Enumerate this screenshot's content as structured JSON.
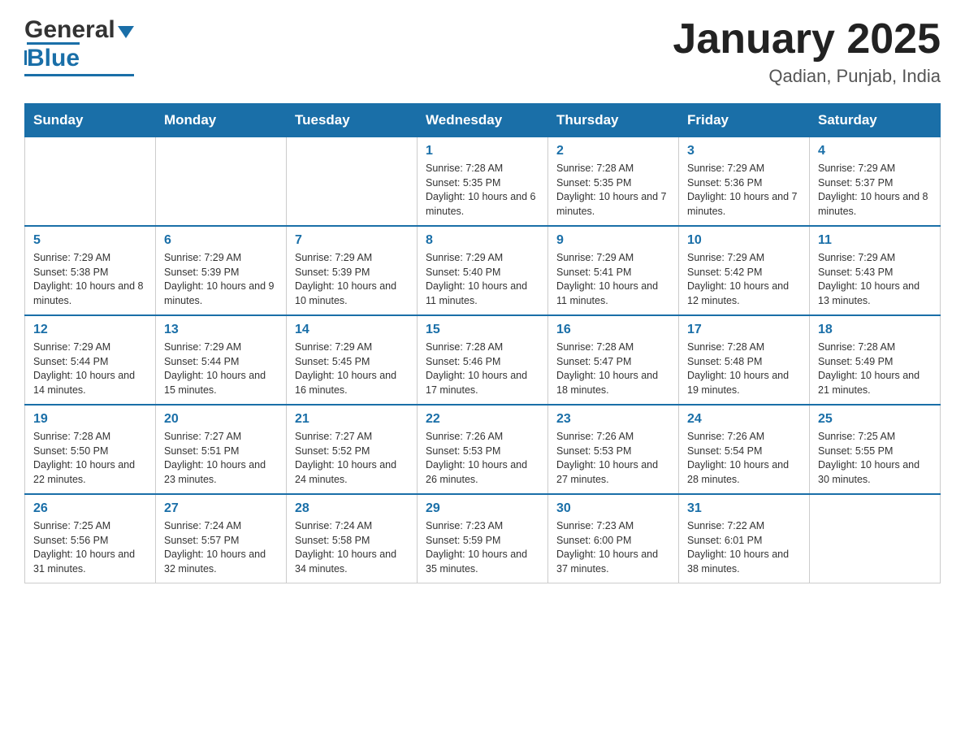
{
  "header": {
    "logo_general": "General",
    "logo_blue": "Blue",
    "month_title": "January 2025",
    "location": "Qadian, Punjab, India"
  },
  "days_of_week": [
    "Sunday",
    "Monday",
    "Tuesday",
    "Wednesday",
    "Thursday",
    "Friday",
    "Saturday"
  ],
  "weeks": [
    [
      {
        "day": "",
        "info": ""
      },
      {
        "day": "",
        "info": ""
      },
      {
        "day": "",
        "info": ""
      },
      {
        "day": "1",
        "info": "Sunrise: 7:28 AM\nSunset: 5:35 PM\nDaylight: 10 hours and 6 minutes."
      },
      {
        "day": "2",
        "info": "Sunrise: 7:28 AM\nSunset: 5:35 PM\nDaylight: 10 hours and 7 minutes."
      },
      {
        "day": "3",
        "info": "Sunrise: 7:29 AM\nSunset: 5:36 PM\nDaylight: 10 hours and 7 minutes."
      },
      {
        "day": "4",
        "info": "Sunrise: 7:29 AM\nSunset: 5:37 PM\nDaylight: 10 hours and 8 minutes."
      }
    ],
    [
      {
        "day": "5",
        "info": "Sunrise: 7:29 AM\nSunset: 5:38 PM\nDaylight: 10 hours and 8 minutes."
      },
      {
        "day": "6",
        "info": "Sunrise: 7:29 AM\nSunset: 5:39 PM\nDaylight: 10 hours and 9 minutes."
      },
      {
        "day": "7",
        "info": "Sunrise: 7:29 AM\nSunset: 5:39 PM\nDaylight: 10 hours and 10 minutes."
      },
      {
        "day": "8",
        "info": "Sunrise: 7:29 AM\nSunset: 5:40 PM\nDaylight: 10 hours and 11 minutes."
      },
      {
        "day": "9",
        "info": "Sunrise: 7:29 AM\nSunset: 5:41 PM\nDaylight: 10 hours and 11 minutes."
      },
      {
        "day": "10",
        "info": "Sunrise: 7:29 AM\nSunset: 5:42 PM\nDaylight: 10 hours and 12 minutes."
      },
      {
        "day": "11",
        "info": "Sunrise: 7:29 AM\nSunset: 5:43 PM\nDaylight: 10 hours and 13 minutes."
      }
    ],
    [
      {
        "day": "12",
        "info": "Sunrise: 7:29 AM\nSunset: 5:44 PM\nDaylight: 10 hours and 14 minutes."
      },
      {
        "day": "13",
        "info": "Sunrise: 7:29 AM\nSunset: 5:44 PM\nDaylight: 10 hours and 15 minutes."
      },
      {
        "day": "14",
        "info": "Sunrise: 7:29 AM\nSunset: 5:45 PM\nDaylight: 10 hours and 16 minutes."
      },
      {
        "day": "15",
        "info": "Sunrise: 7:28 AM\nSunset: 5:46 PM\nDaylight: 10 hours and 17 minutes."
      },
      {
        "day": "16",
        "info": "Sunrise: 7:28 AM\nSunset: 5:47 PM\nDaylight: 10 hours and 18 minutes."
      },
      {
        "day": "17",
        "info": "Sunrise: 7:28 AM\nSunset: 5:48 PM\nDaylight: 10 hours and 19 minutes."
      },
      {
        "day": "18",
        "info": "Sunrise: 7:28 AM\nSunset: 5:49 PM\nDaylight: 10 hours and 21 minutes."
      }
    ],
    [
      {
        "day": "19",
        "info": "Sunrise: 7:28 AM\nSunset: 5:50 PM\nDaylight: 10 hours and 22 minutes."
      },
      {
        "day": "20",
        "info": "Sunrise: 7:27 AM\nSunset: 5:51 PM\nDaylight: 10 hours and 23 minutes."
      },
      {
        "day": "21",
        "info": "Sunrise: 7:27 AM\nSunset: 5:52 PM\nDaylight: 10 hours and 24 minutes."
      },
      {
        "day": "22",
        "info": "Sunrise: 7:26 AM\nSunset: 5:53 PM\nDaylight: 10 hours and 26 minutes."
      },
      {
        "day": "23",
        "info": "Sunrise: 7:26 AM\nSunset: 5:53 PM\nDaylight: 10 hours and 27 minutes."
      },
      {
        "day": "24",
        "info": "Sunrise: 7:26 AM\nSunset: 5:54 PM\nDaylight: 10 hours and 28 minutes."
      },
      {
        "day": "25",
        "info": "Sunrise: 7:25 AM\nSunset: 5:55 PM\nDaylight: 10 hours and 30 minutes."
      }
    ],
    [
      {
        "day": "26",
        "info": "Sunrise: 7:25 AM\nSunset: 5:56 PM\nDaylight: 10 hours and 31 minutes."
      },
      {
        "day": "27",
        "info": "Sunrise: 7:24 AM\nSunset: 5:57 PM\nDaylight: 10 hours and 32 minutes."
      },
      {
        "day": "28",
        "info": "Sunrise: 7:24 AM\nSunset: 5:58 PM\nDaylight: 10 hours and 34 minutes."
      },
      {
        "day": "29",
        "info": "Sunrise: 7:23 AM\nSunset: 5:59 PM\nDaylight: 10 hours and 35 minutes."
      },
      {
        "day": "30",
        "info": "Sunrise: 7:23 AM\nSunset: 6:00 PM\nDaylight: 10 hours and 37 minutes."
      },
      {
        "day": "31",
        "info": "Sunrise: 7:22 AM\nSunset: 6:01 PM\nDaylight: 10 hours and 38 minutes."
      },
      {
        "day": "",
        "info": ""
      }
    ]
  ]
}
